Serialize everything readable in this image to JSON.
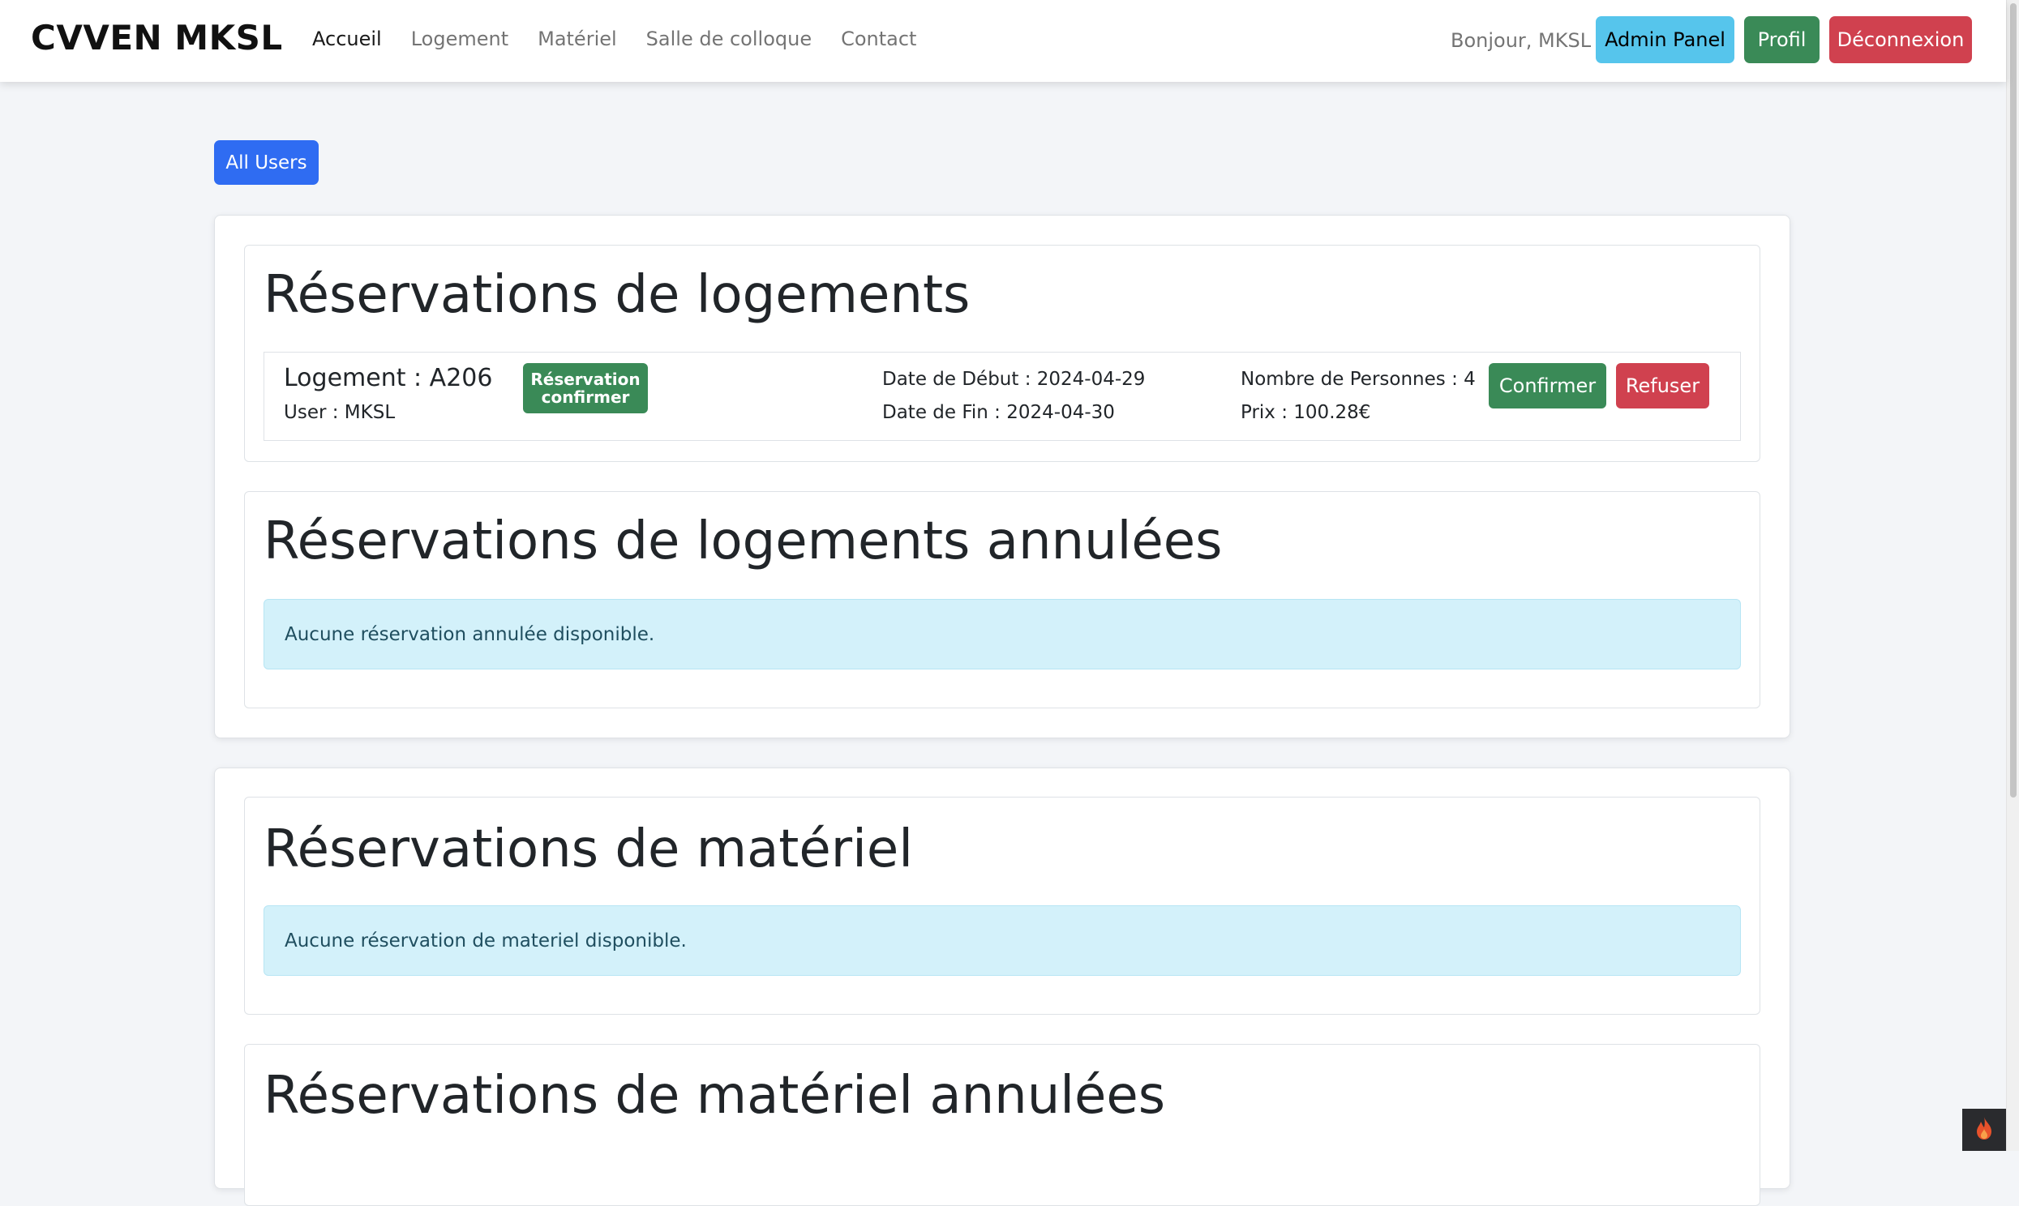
{
  "navbar": {
    "brand": "CVVEN MKSL",
    "links": [
      {
        "label": "Accueil"
      },
      {
        "label": "Logement"
      },
      {
        "label": "Matériel"
      },
      {
        "label": "Salle de colloque"
      },
      {
        "label": "Contact"
      }
    ],
    "greeting": "Bonjour, MKSL",
    "admin_label": "Admin Panel",
    "profil_label": "Profil",
    "logout_label": "Déconnexion"
  },
  "main": {
    "all_users_label": "All Users",
    "sections": {
      "logements_title": "Réservations de logements",
      "logements_annulees_title": "Réservations de logements annulées",
      "materiel_title": "Réservations de matériel",
      "materiel_annulees_title": "Réservations de matériel annulées"
    },
    "reservation": {
      "logement": "Logement : A206",
      "user": "User : MKSL",
      "status": "Réservation confirmer",
      "date_debut": "Date de Début : 2024-04-29",
      "date_fin": "Date de Fin : 2024-04-30",
      "personnes": "Nombre de Personnes : 4",
      "prix": "Prix : 100.28€",
      "confirm_label": "Confirmer",
      "refuse_label": "Refuser"
    },
    "alerts": {
      "logements_annulees": "Aucune réservation annulée disponible.",
      "materiel": "Aucune réservation de materiel disponible."
    }
  },
  "colors": {
    "primary": "#2f6cf2",
    "success": "#3a8a57",
    "danger": "#d0414f",
    "info": "#56c5ec",
    "alert_bg": "#d3f1fa"
  },
  "icons": {
    "bottom_widget": "flame-icon"
  }
}
